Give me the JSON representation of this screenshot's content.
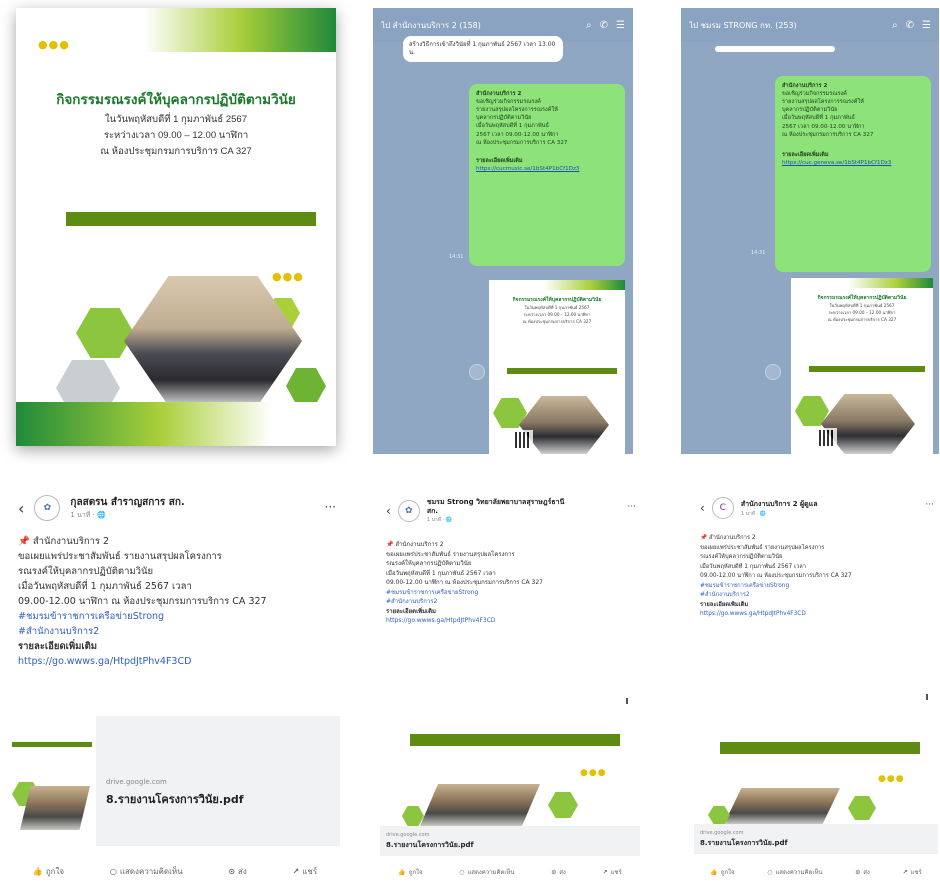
{
  "poster": {
    "dots": "●●●",
    "title": "กิจกรรมรณรงค์ให้บุคลากรปฏิบัติตามวินัย",
    "line1": "ในวันพฤหัสบดีที่ 1 กุมภาพันธ์ 2567",
    "line2": "ระหว่างเวลา 09.00 – 12.00 นาฬิกา",
    "line3": "ณ ห้องประชุมกรมการบริการ CA 327"
  },
  "chat1": {
    "header": "ไป  สำนักงานบริการ 2 (158)",
    "white_bubble": "สร้างวิธีการเข้าถึงวินัยที่ 1 กุมภาพันธ์ 2567 เวลา 13.00 น.",
    "green_title": "สำนักงานบริการ 2",
    "green_lines": [
      "ขอเชิญร่วมกิจกรรมรณรงค์",
      "รายงานสรุปผลโครงการรณรงค์ให้",
      "บุคลากรปฏิบัติตามวินัย",
      "เมื่อวันพฤหัสบดีที่ 1 กุมภาพันธ์",
      "2567 เวลา 09.00-12.00 นาฬิกา",
      "ณ ห้องประชุมกรมการบริการ CA 327"
    ],
    "cta": "รายละเอียดเพิ่มเติม",
    "link": "https://cucmusic.se/1bSt4P1bCf1Dz3",
    "time": "14:31"
  },
  "chat2": {
    "header": "ไป  ชมรม STRONG กท. (253)",
    "green_title": "สำนักงานบริการ 2",
    "green_lines": [
      "ขอเชิญร่วมกิจกรรมรณรงค์",
      "รายงานสรุปผลโครงการรณรงค์ให้",
      "บุคลากรปฏิบัติตามวินัย",
      "เมื่อวันพฤหัสบดีที่ 1 กุมภาพันธ์",
      "2567 เวลา 09.00-12.00 นาฬิกา",
      "ณ ห้องประชุมกรมการบริการ CA 327"
    ],
    "cta": "รายละเอียดเพิ่มเติม",
    "link": "https://cuc.geneva.se/1bSt4P1bCf1Dz3",
    "time": "14:31"
  },
  "fb1": {
    "name": "กุลสตรน สำราญสการ สก.",
    "meta": "1 นาที · 🌐",
    "lines": [
      "📌 สำนักงานบริการ 2",
      "     ขอเผยแพร่ประชาสัมพันธ์ รายงานสรุปผลโครงการ",
      "รณรงค์ให้บุคลากรปฏิบัติตามวินัย",
      "     เมื่อวันพฤหัสบดีที่ 1 กุมภาพันธ์ 2567 เวลา",
      "09.00-12.00 นาฬิกา ณ ห้องประชุมกรมการบริการ CA 327"
    ],
    "tags": [
      "#ชมรมข้าราชการเครือข่ายStrong",
      "#สำนักงานบริการ2"
    ],
    "detail_label": "รายละเอียดเพิ่มเติม",
    "detail_link": "https://go.wwws.ga/HtpdJtPhv4F3CD",
    "domain": "drive.google.com",
    "file": "8.รายงานโครงการวินัย.pdf",
    "actions": [
      "ถูกใจ",
      "แสดงความคิดเห็น",
      "ส่ง",
      "แชร์"
    ]
  },
  "fb2": {
    "name": "ชมรม Strong วิทยาลัยพยาบาลสุราษฎร์ธานี สก.",
    "meta": "1 นาที · 🌐",
    "lines": [
      "📌 สำนักงานบริการ 2",
      "     ขอเผยแพร่ประชาสัมพันธ์ รายงานสรุปผลโครงการ",
      "รณรงค์ให้บุคลากรปฏิบัติตามวินัย",
      "     เมื่อวันพฤหัสบดีที่ 1 กุมภาพันธ์ 2567 เวลา",
      "09.00-12.00 นาฬิกา ณ ห้องประชุมกรมการบริการ CA 327"
    ],
    "tags": [
      "#ชมรมข้าราชการเครือข่ายStrong",
      "#สำนักงานบริการ2"
    ],
    "detail_label": "รายละเอียดเพิ่มเติม",
    "detail_link": "https://go.wwws.ga/HtpdJtPhv4F3CD",
    "domain": "drive.google.com",
    "file": "8.รายงานโครงการวินัย.pdf",
    "actions": [
      "ถูกใจ",
      "แสดงความคิดเห็น",
      "ส่ง",
      "แชร์"
    ]
  },
  "fb3": {
    "name": "สำนักงานบริการ 2 ผู้ดูแล",
    "meta": "1 นาที · 🌐",
    "lines": [
      "📌 สำนักงานบริการ 2",
      "     ขอเผยแพร่ประชาสัมพันธ์ รายงานสรุปผลโครงการ",
      "รณรงค์ให้บุคลากรปฏิบัติตามวินัย",
      "     เมื่อวันพฤหัสบดีที่ 1 กุมภาพันธ์ 2567 เวลา",
      "09.00-12.00 นาฬิกา ณ ห้องประชุมกรมการบริการ CA 327"
    ],
    "tags": [
      "#ชมรมข้าราชการเครือข่ายStrong",
      "#สำนักงานบริการ2"
    ],
    "detail_label": "รายละเอียดเพิ่มเติม",
    "detail_link": "https://go.wwws.ga/HtpdJtPhv4F3CD",
    "domain": "drive.google.com",
    "file": "8.รายงานโครงการวินัย.pdf",
    "actions": [
      "ถูกใจ",
      "แสดงความคิดเห็น",
      "ส่ง",
      "แชร์"
    ]
  },
  "colors": {
    "brand_green": "#1b7a2c",
    "bar_green": "#5e8c12",
    "chat_bg": "#8fa7c3",
    "bubble_green": "#8de37a",
    "link_blue": "#2f5fc4"
  }
}
